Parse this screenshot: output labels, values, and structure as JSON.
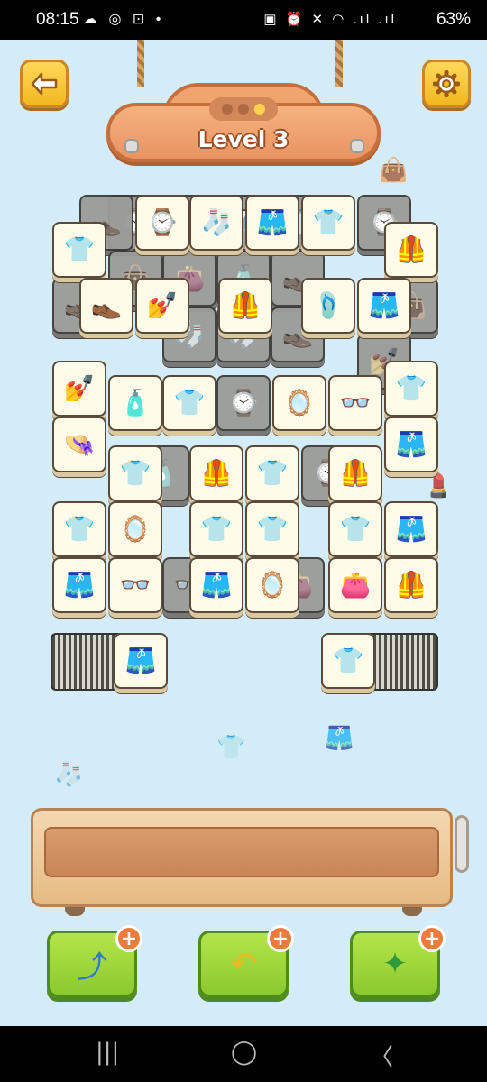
{
  "status_bar": {
    "time": "08:15",
    "left_icons": "☁ ◎ ⊡ •",
    "right_icons": "▣ ⏰ ✕ ◠ .ıl .ıl",
    "battery": "63%"
  },
  "header": {
    "level_label": "Level  3",
    "progress_dots": [
      false,
      false,
      true
    ]
  },
  "tiles": [
    {
      "icon": "⌚",
      "dim": true
    },
    {
      "icon": "🧦",
      "dim": true
    },
    {
      "icon": "🩳",
      "dim": true
    },
    {
      "icon": "👕",
      "dim": true
    },
    {
      "icon": "👞",
      "dim": true
    },
    {
      "icon": "⌚",
      "dim": false
    },
    {
      "icon": "🧦",
      "dim": false
    },
    {
      "icon": "🩳",
      "dim": false
    },
    {
      "icon": "👕",
      "dim": false
    },
    {
      "icon": "⌚",
      "dim": true
    },
    {
      "icon": "👕",
      "dim": false
    },
    {
      "icon": "🦺",
      "dim": false
    },
    {
      "icon": "👜",
      "dim": true
    },
    {
      "icon": "👛",
      "dim": true
    },
    {
      "icon": "🧴",
      "dim": true
    },
    {
      "icon": "👞",
      "dim": true
    },
    {
      "icon": "👞",
      "dim": true
    },
    {
      "icon": "👞",
      "dim": false
    },
    {
      "icon": "💅",
      "dim": false
    },
    {
      "icon": "🦺",
      "dim": false
    },
    {
      "icon": "🩴",
      "dim": false
    },
    {
      "icon": "🩳",
      "dim": false
    },
    {
      "icon": "👜",
      "dim": true
    },
    {
      "icon": "🧦",
      "dim": true
    },
    {
      "icon": "🧦",
      "dim": true
    },
    {
      "icon": "👞",
      "dim": true
    },
    {
      "icon": "💅",
      "dim": true
    },
    {
      "icon": "💅",
      "dim": false
    },
    {
      "icon": "🧴",
      "dim": false
    },
    {
      "icon": "👕",
      "dim": false
    },
    {
      "icon": "⌚",
      "dim": true
    },
    {
      "icon": "🪞",
      "dim": false
    },
    {
      "icon": "👓",
      "dim": false
    },
    {
      "icon": "👕",
      "dim": false
    },
    {
      "icon": "👒",
      "dim": false
    },
    {
      "icon": "👕",
      "dim": false
    },
    {
      "icon": "🧴",
      "dim": true
    },
    {
      "icon": "🦺",
      "dim": false
    },
    {
      "icon": "👕",
      "dim": false
    },
    {
      "icon": "⌚",
      "dim": true
    },
    {
      "icon": "🦺",
      "dim": false
    },
    {
      "icon": "🩳",
      "dim": false
    },
    {
      "icon": "👕",
      "dim": false
    },
    {
      "icon": "🪞",
      "dim": false
    },
    {
      "icon": "👕",
      "dim": false
    },
    {
      "icon": "👕",
      "dim": false
    },
    {
      "icon": "👕",
      "dim": false
    },
    {
      "icon": "🩳",
      "dim": false
    },
    {
      "icon": "🩳",
      "dim": false
    },
    {
      "icon": "👓",
      "dim": false
    },
    {
      "icon": "👓",
      "dim": true
    },
    {
      "icon": "🩳",
      "dim": false
    },
    {
      "icon": "🪞",
      "dim": false
    },
    {
      "icon": "👛",
      "dim": true
    },
    {
      "icon": "👛",
      "dim": false
    },
    {
      "icon": "🦺",
      "dim": false
    }
  ],
  "side_stacks": [
    {
      "top_icon": "🩳"
    },
    {
      "top_icon": "👕"
    }
  ],
  "powerups": [
    {
      "name": "shuffle",
      "icon": "⤴",
      "plus": "+"
    },
    {
      "name": "undo",
      "icon": "↶",
      "plus": "+"
    },
    {
      "name": "magic",
      "icon": "✦",
      "plus": "+"
    }
  ],
  "nav": {
    "recent": "|||",
    "home": "◯",
    "back": "〈"
  }
}
